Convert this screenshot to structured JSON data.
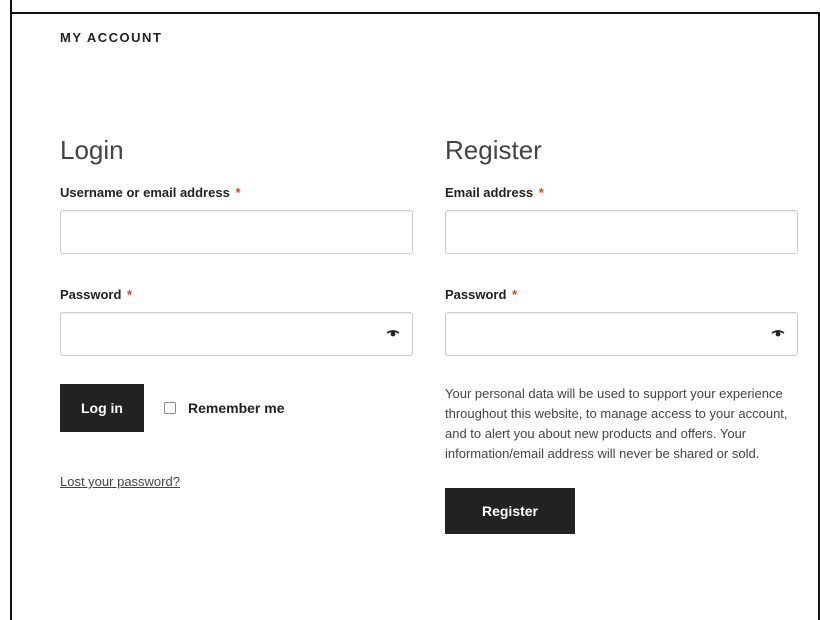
{
  "page": {
    "title": "MY ACCOUNT"
  },
  "login": {
    "heading": "Login",
    "username_label": "Username or email address",
    "password_label": "Password",
    "required_mark": "*",
    "submit_label": "Log in",
    "remember_label": "Remember me",
    "lost_password_label": "Lost your password?",
    "username_value": "",
    "password_value": ""
  },
  "register": {
    "heading": "Register",
    "email_label": "Email address",
    "password_label": "Password",
    "required_mark": "*",
    "privacy_text": "Your personal data will be used to support your experience throughout this website, to manage access to your account, and to alert you about new products and offers. Your information/email address will never be shared or sold.",
    "submit_label": "Register",
    "email_value": "",
    "password_value": ""
  },
  "icons": {
    "password_toggle": "eye-icon"
  },
  "colors": {
    "button_bg": "#222222",
    "required": "#e2401c"
  }
}
